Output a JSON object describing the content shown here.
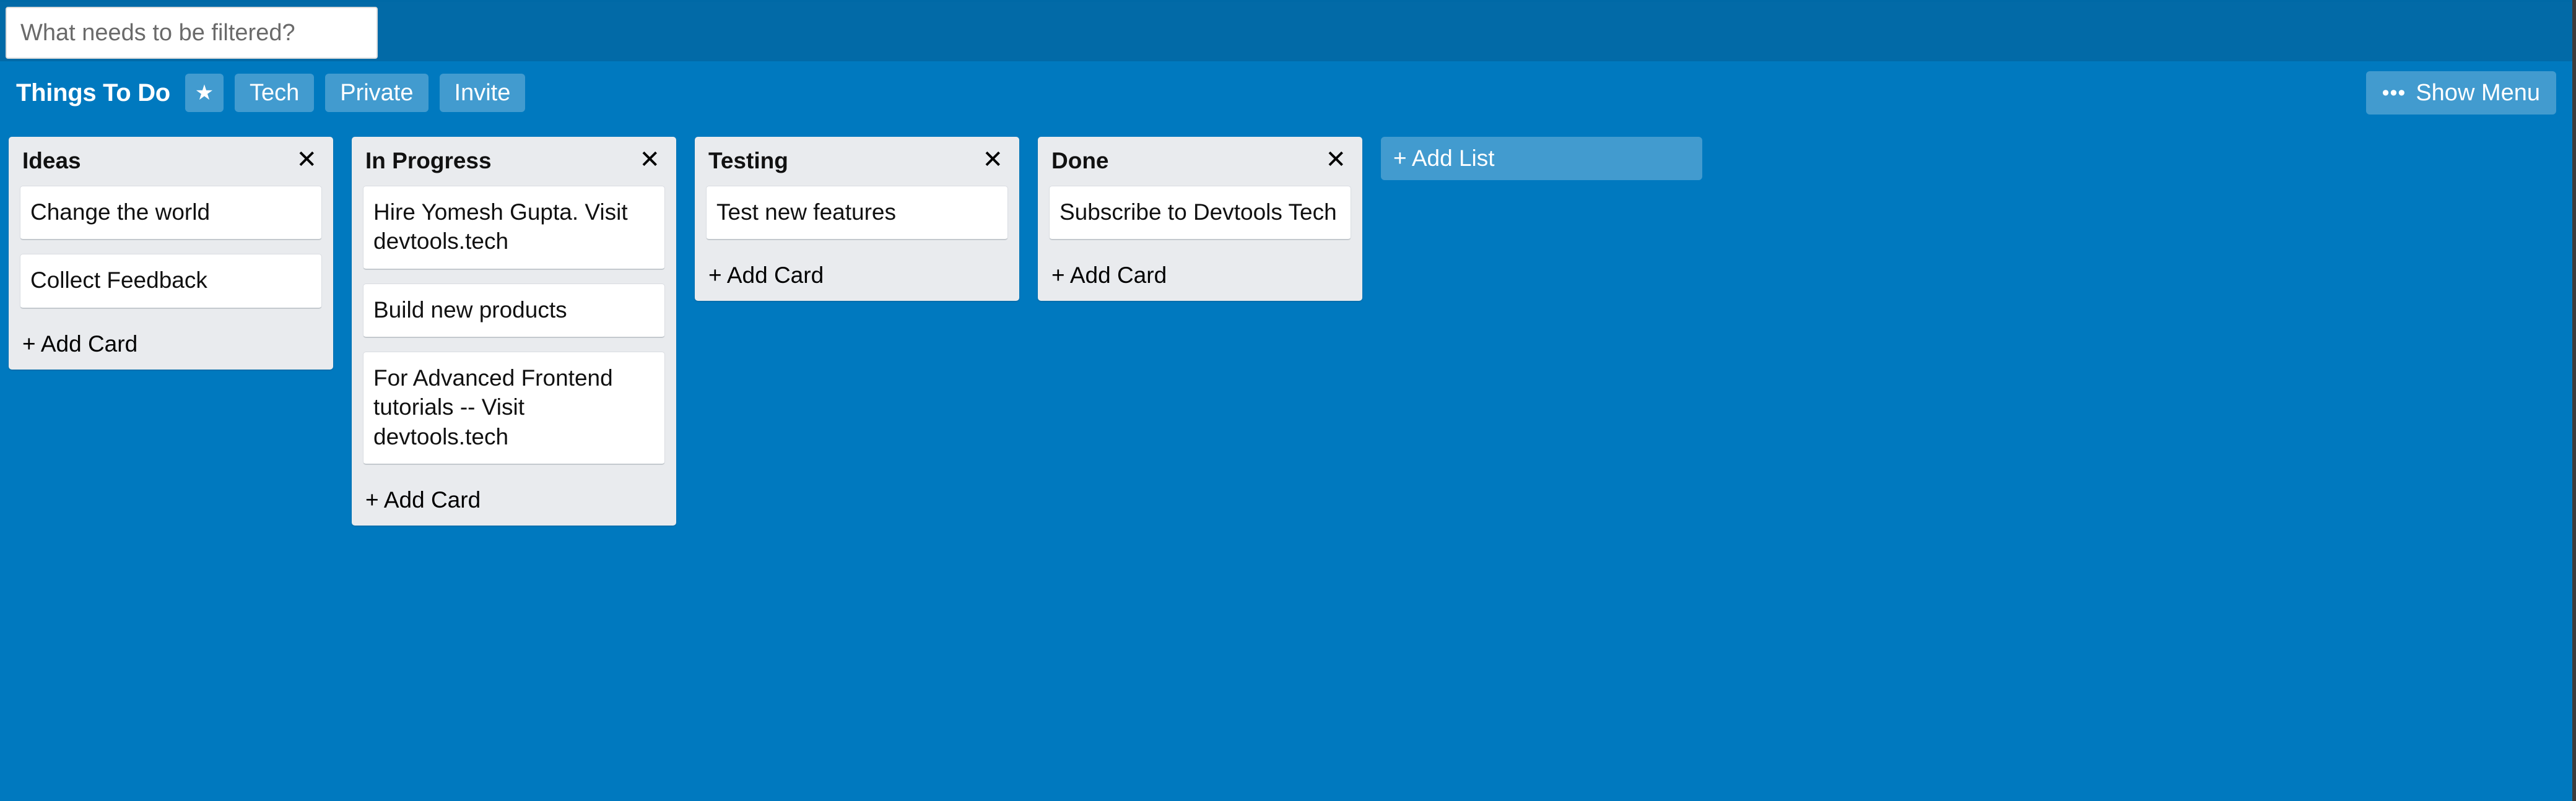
{
  "filter": {
    "placeholder": "What needs to be filtered?",
    "value": ""
  },
  "header": {
    "title": "Things To Do",
    "star_label": "★",
    "buttons": [
      {
        "label": "Tech"
      },
      {
        "label": "Private"
      },
      {
        "label": "Invite"
      }
    ],
    "show_menu": {
      "icon": "•••",
      "label": "Show Menu"
    }
  },
  "board": {
    "add_list_label": "+ Add List",
    "close_icon": "✕",
    "lists": [
      {
        "title": "Ideas",
        "add_card_label": "+ Add Card",
        "cards": [
          {
            "text": "Change the world"
          },
          {
            "text": "Collect Feedback"
          }
        ]
      },
      {
        "title": "In Progress",
        "add_card_label": "+ Add Card",
        "cards": [
          {
            "text": "Hire Yomesh Gupta. Visit devtools.tech"
          },
          {
            "text": "Build new products"
          },
          {
            "text": "For Advanced Frontend tutorials -- Visit devtools.tech"
          }
        ]
      },
      {
        "title": "Testing",
        "add_card_label": "+ Add Card",
        "cards": [
          {
            "text": "Test new features"
          }
        ]
      },
      {
        "title": "Done",
        "add_card_label": "+ Add Card",
        "cards": [
          {
            "text": "Subscribe to Devtools Tech"
          }
        ]
      }
    ]
  },
  "colors": {
    "top_bar": "#026AA7",
    "board_bg": "#0079BF",
    "list_bg": "#E9EBEE",
    "card_bg": "#FFFFFF",
    "button_overlay": "rgba(255,255,255,0.26)"
  }
}
